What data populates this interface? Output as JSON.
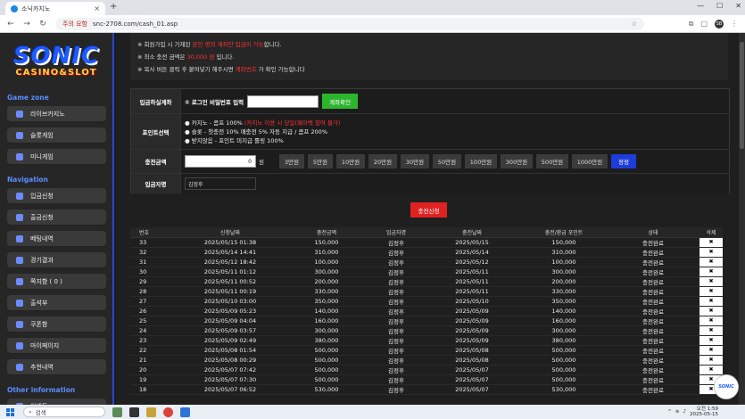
{
  "browser": {
    "tab_title": "소닉카지노",
    "url_security": "주의 요함",
    "url": "snc-2708.com/cash_01.asp",
    "profile": "SB"
  },
  "sidebar": {
    "logo_top": "SONIC",
    "logo_bottom": "CASINO&SLOT",
    "sections": [
      {
        "title": "Game zone",
        "items": [
          "라이브카지노",
          "슬롯게임",
          "미니게임"
        ]
      },
      {
        "title": "Navigation",
        "items": [
          "입금신청",
          "출금신청",
          "베팅내역",
          "경기결과",
          "쪽지함 ( 0 )",
          "출석부",
          "쿠폰함",
          "마이페이지",
          "추천내역"
        ]
      },
      {
        "title": "Other information",
        "items": [
          "이벤트"
        ]
      }
    ]
  },
  "notice": {
    "line1_a": "※ 회원가입 시 기재된 ",
    "line1_b": "본인 명의 계좌만 입금이 가능",
    "line1_c": "합니다.",
    "line2_a": "※ 최소 충전 금액은 ",
    "line2_b": "30,000 원",
    "line2_c": " 입니다.",
    "line3_a": "※ 복사 버튼 클릭 후 붙여넣기 해주시면 ",
    "line3_b": "계좌번호",
    "line3_c": " 가 확인 가능합니다"
  },
  "form": {
    "account_label": "입금하실계좌",
    "pw_label": "① 로그인 비밀번호 입력",
    "account_btn": "계좌확인",
    "point_label": "포인트선택",
    "point_opt1_a": "● 카지노 - 콤프 100%",
    "point_opt1_b": " (카지노 이용 시 당일(페이백 참여 불가)",
    "point_opt2": "● 슬롯 - 첫충전 10% 매충전 5% 자동 지급 / 콤프 200%",
    "point_opt3": "● 받지않음 - 포인트 미지급 롤링 100%",
    "amount_label": "충전금액",
    "amount_value": "0",
    "amount_unit": "원",
    "amount_buttons": [
      "3만원",
      "5만원",
      "10만원",
      "20만원",
      "30만원",
      "50만원",
      "100만원",
      "300만원",
      "500만원",
      "1000만원"
    ],
    "reset_btn": "정정",
    "depositor_label": "입금자명",
    "depositor_value": "김정후"
  },
  "submit_label": "충전신청",
  "table": {
    "headers": [
      "번호",
      "신청날짜",
      "충전금액",
      "입금자명",
      "충전날짜",
      "충전/환급 포인트",
      "상태",
      "삭제"
    ],
    "rows": [
      [
        "33",
        "2025/05/15 01:38",
        "150,000",
        "김정후",
        "2025/05/15",
        "150,000",
        "충전완료",
        "✖"
      ],
      [
        "32",
        "2025/05/14 14:41",
        "310,000",
        "김정후",
        "2025/05/14",
        "310,000",
        "충전완료",
        "✖"
      ],
      [
        "31",
        "2025/05/12 18:42",
        "100,000",
        "김정후",
        "2025/05/12",
        "100,000",
        "충전완료",
        "✖"
      ],
      [
        "30",
        "2025/05/11 01:12",
        "300,000",
        "김정후",
        "2025/05/11",
        "300,000",
        "충전완료",
        "✖"
      ],
      [
        "29",
        "2025/05/11 00:52",
        "200,000",
        "김정후",
        "2025/05/11",
        "200,000",
        "충전완료",
        "✖"
      ],
      [
        "28",
        "2025/05/11 00:19",
        "330,000",
        "김정후",
        "2025/05/11",
        "330,000",
        "충전완료",
        "✖"
      ],
      [
        "27",
        "2025/05/10 03:00",
        "350,000",
        "김정후",
        "2025/05/10",
        "350,000",
        "충전완료",
        "✖"
      ],
      [
        "26",
        "2025/05/09 05:23",
        "140,000",
        "김정후",
        "2025/05/09",
        "140,000",
        "충전완료",
        "✖"
      ],
      [
        "25",
        "2025/05/09 04:04",
        "160,000",
        "김정후",
        "2025/05/09",
        "160,000",
        "충전완료",
        "✖"
      ],
      [
        "24",
        "2025/05/09 03:57",
        "300,000",
        "김정후",
        "2025/05/09",
        "300,000",
        "충전완료",
        "✖"
      ],
      [
        "23",
        "2025/05/09 02:49",
        "380,000",
        "김정후",
        "2025/05/09",
        "380,000",
        "충전완료",
        "✖"
      ],
      [
        "22",
        "2025/05/08 01:54",
        "500,000",
        "김정후",
        "2025/05/08",
        "500,000",
        "충전완료",
        "✖"
      ],
      [
        "21",
        "2025/05/08 00:29",
        "500,000",
        "김정후",
        "2025/05/08",
        "500,000",
        "충전완료",
        "✖"
      ],
      [
        "20",
        "2025/05/07 07:42",
        "500,000",
        "김정후",
        "2025/05/07",
        "500,000",
        "충전완료",
        "✖"
      ],
      [
        "19",
        "2025/05/07 07:30",
        "500,000",
        "김정후",
        "2025/05/07",
        "500,000",
        "충전완료",
        "✖"
      ],
      [
        "18",
        "2025/05/07 06:52",
        "530,000",
        "김정후",
        "2025/05/07",
        "530,000",
        "충전완료",
        "✖"
      ]
    ]
  },
  "taskbar": {
    "search": "검색",
    "time": "오전 1:59",
    "date": "2025-05-15"
  }
}
